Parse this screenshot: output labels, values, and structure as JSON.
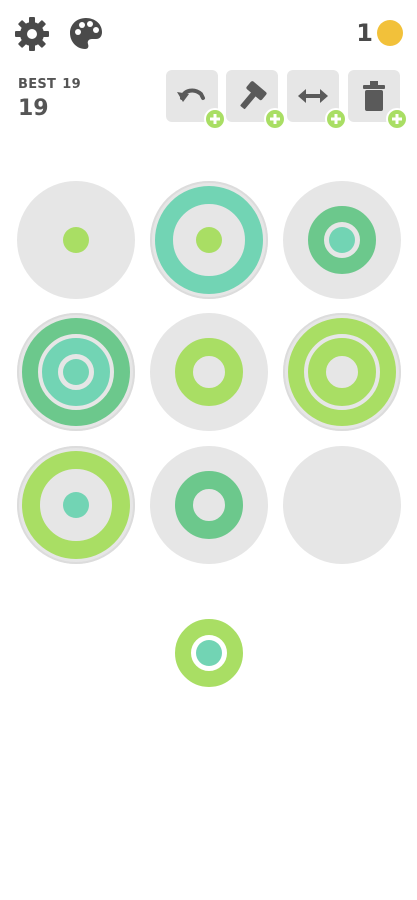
{
  "colors": {
    "board": "#e6e6e6",
    "lime": "#a9de64",
    "green": "#6cc88c",
    "teal": "#72d4b4",
    "coin": "#f2c13a",
    "text": "#4a4a4a"
  },
  "header": {
    "coins": "1",
    "best_label": "BEST",
    "best_value": "19",
    "score": "19"
  },
  "toolbar": {
    "items": [
      {
        "name": "undo",
        "icon": "undo-icon"
      },
      {
        "name": "hammer",
        "icon": "hammer-icon"
      },
      {
        "name": "swap",
        "icon": "swap-arrows-icon"
      },
      {
        "name": "trash",
        "icon": "trash-icon"
      }
    ]
  },
  "board": {
    "rows": [
      [
        {
          "small": "lime",
          "medium": null,
          "large": null
        },
        {
          "small": "lime",
          "medium": null,
          "large": "teal"
        },
        {
          "small": "teal",
          "medium": "green",
          "large": null
        }
      ],
      [
        {
          "small": "teal",
          "medium": "teal",
          "large": "green"
        },
        {
          "small": null,
          "medium": "lime",
          "large": null
        },
        {
          "small": null,
          "medium": "lime",
          "large": "lime"
        }
      ],
      [
        {
          "small": "teal",
          "medium": null,
          "large": "lime"
        },
        {
          "small": null,
          "medium": "green",
          "large": null
        },
        {
          "small": null,
          "medium": null,
          "large": null
        }
      ]
    ]
  },
  "next_piece": {
    "small": "teal",
    "medium": "lime",
    "large": null
  }
}
